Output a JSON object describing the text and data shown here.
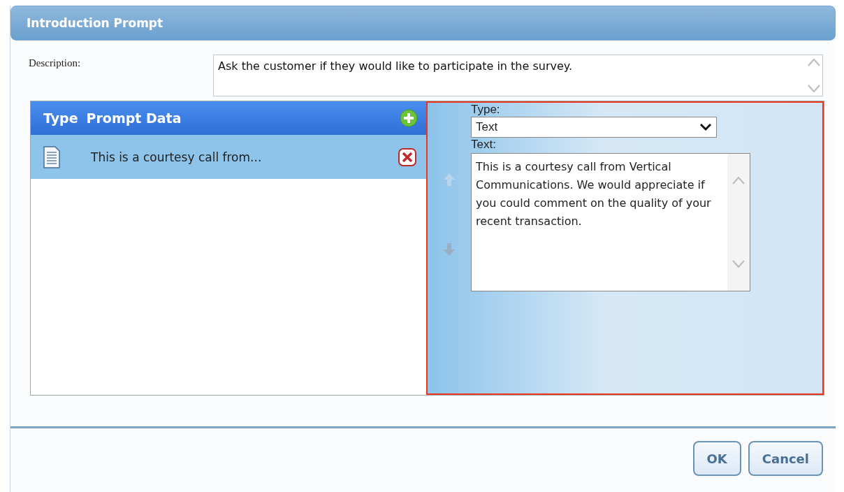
{
  "window": {
    "title": "Introduction Prompt"
  },
  "description": {
    "label": "Description:",
    "value": "Ask the customer if they would like to participate in the survey."
  },
  "prompt_list": {
    "columns": [
      "Type",
      "Prompt Data"
    ],
    "rows": [
      {
        "text": "This is a courtesy call from...",
        "selected": true
      }
    ]
  },
  "editor": {
    "type_label": "Type:",
    "type_value": "Text",
    "text_label": "Text:",
    "text_value": "This is a courtesy call from Vertical Communications. We would appreciate if you could comment on the quality of your recent transaction."
  },
  "buttons": [
    "OK",
    "Cancel"
  ]
}
